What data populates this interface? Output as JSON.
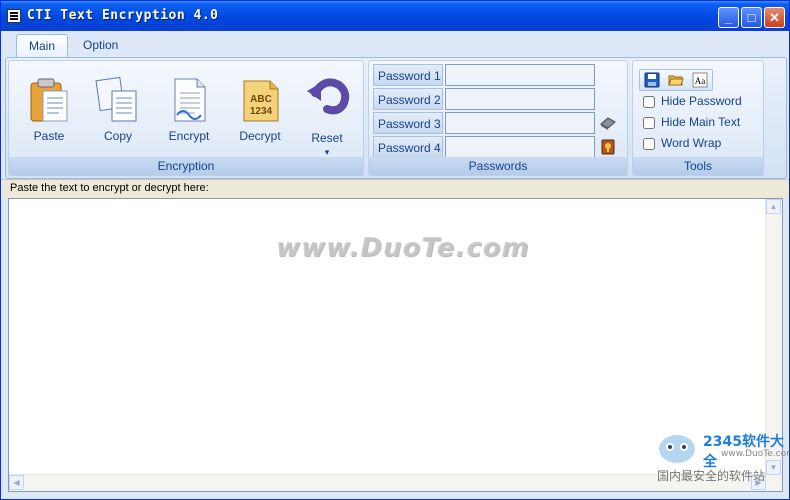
{
  "window": {
    "title": "CTI Text Encryption 4.0",
    "minimize": "_",
    "maximize": "□",
    "close": "✕"
  },
  "tabs": [
    {
      "label": "Main",
      "active": true
    },
    {
      "label": "Option",
      "active": false
    }
  ],
  "ribbon": {
    "encryption": {
      "label": "Encryption",
      "buttons": [
        {
          "label": "Paste",
          "icon": "paste-icon"
        },
        {
          "label": "Copy",
          "icon": "copy-icon"
        },
        {
          "label": "Encrypt",
          "icon": "encrypt-icon"
        },
        {
          "label": "Decrypt",
          "icon": "decrypt-icon"
        },
        {
          "label": "Reset",
          "icon": "reset-icon",
          "dropdown": "▾"
        }
      ],
      "decrypt_icon_text": [
        "ABC",
        "1234"
      ]
    },
    "passwords": {
      "label": "Passwords",
      "fields": [
        {
          "label": "Password 1",
          "value": ""
        },
        {
          "label": "Password 2",
          "value": ""
        },
        {
          "label": "Password 3",
          "value": "",
          "tool": "eraser-icon"
        },
        {
          "label": "Password 4",
          "value": "",
          "tool": "keybook-icon"
        }
      ]
    },
    "tools": {
      "label": "Tools",
      "toolbar": [
        "save-icon",
        "open-folder-icon",
        "font-icon"
      ],
      "font_icon_text": "Aa",
      "checkboxes": [
        {
          "label": "Hide Password",
          "checked": false
        },
        {
          "label": "Hide Main Text",
          "checked": false
        },
        {
          "label": "Word Wrap",
          "checked": false
        }
      ]
    }
  },
  "editor": {
    "hint": "Paste the text to encrypt or decrypt here:",
    "content": ""
  },
  "watermarks": {
    "center": "www.DuoTe.com",
    "brand": "2345软件大全",
    "url": "www.DuoTe.com",
    "slogan": "国内最安全的软件站"
  },
  "colors": {
    "title_bar": "#0048e0",
    "ribbon_text": "#15428b",
    "ribbon_bg": "#dfe8f6"
  }
}
